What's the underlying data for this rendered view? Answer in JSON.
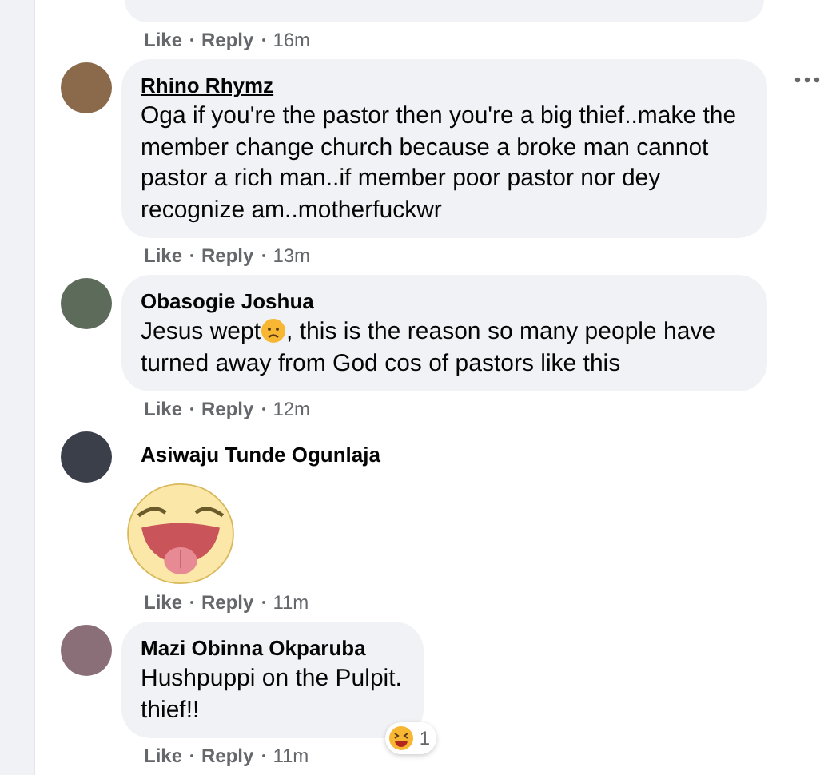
{
  "previous_comment": {
    "actions": [
      "Like",
      "Reply"
    ],
    "time": "16m"
  },
  "comments": [
    {
      "kind": "text",
      "author": "Rhino Rhymz",
      "author_underlined": true,
      "text_parts": [
        "Oga if you're the pastor then you're a big thief..make the member change church because a broke man cannot pastor a rich man..if member poor pastor nor dey recognize am..motherfuckwr"
      ],
      "more_menu": true,
      "actions": [
        "Like",
        "Reply"
      ],
      "time": "13m"
    },
    {
      "kind": "text",
      "author": "Obasogie Joshua",
      "author_underlined": false,
      "text_parts": [
        "Jesus wept",
        ", this is the reason so many people have turned away from God cos of pastors like this"
      ],
      "more_menu": false,
      "actions": [
        "Like",
        "Reply"
      ],
      "time": "12m"
    },
    {
      "kind": "sticker",
      "author": "Asiwaju Tunde Ogunlaja",
      "author_underlined": false,
      "more_menu": false,
      "actions": [
        "Like",
        "Reply"
      ],
      "time": "11m"
    },
    {
      "kind": "text",
      "author": "Mazi Obinna Okparuba",
      "author_underlined": false,
      "text_parts": [
        "Hushpuppi on the Pulpit. thief!!"
      ],
      "more_menu": false,
      "reaction_count": "1",
      "actions": [
        "Like",
        "Reply"
      ],
      "time": "11m"
    }
  ]
}
